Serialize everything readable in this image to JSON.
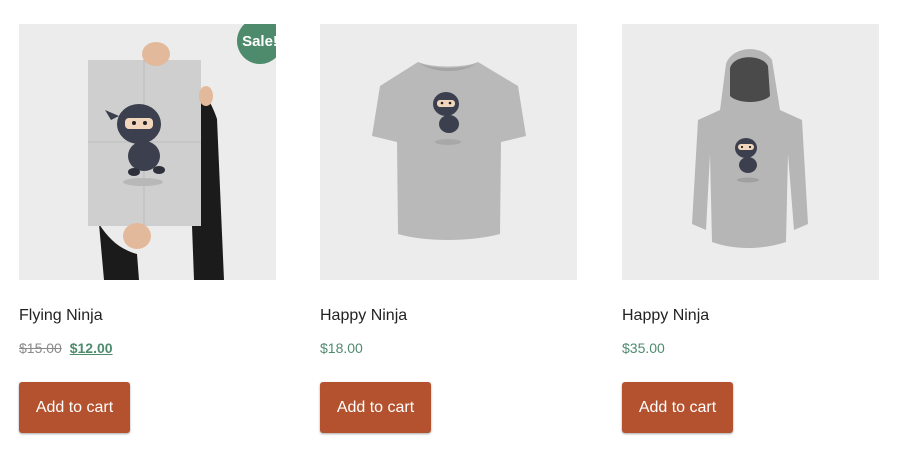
{
  "colors": {
    "accent_green": "#4e8b6d",
    "button_red": "#b4522f",
    "thumb_bg": "#ececec"
  },
  "products": [
    {
      "title": "Flying Ninja",
      "image": "ninja-poster",
      "sale_badge": "Sale!",
      "regular_price": "$15.00",
      "sale_price": "$12.00",
      "price": "",
      "button": "Add to cart"
    },
    {
      "title": "Happy Ninja",
      "image": "ninja-tshirt",
      "sale_badge": "",
      "regular_price": "",
      "sale_price": "",
      "price": "$18.00",
      "button": "Add to cart"
    },
    {
      "title": "Happy Ninja",
      "image": "ninja-hoodie",
      "sale_badge": "",
      "regular_price": "",
      "sale_price": "",
      "price": "$35.00",
      "button": "Add to cart"
    }
  ]
}
